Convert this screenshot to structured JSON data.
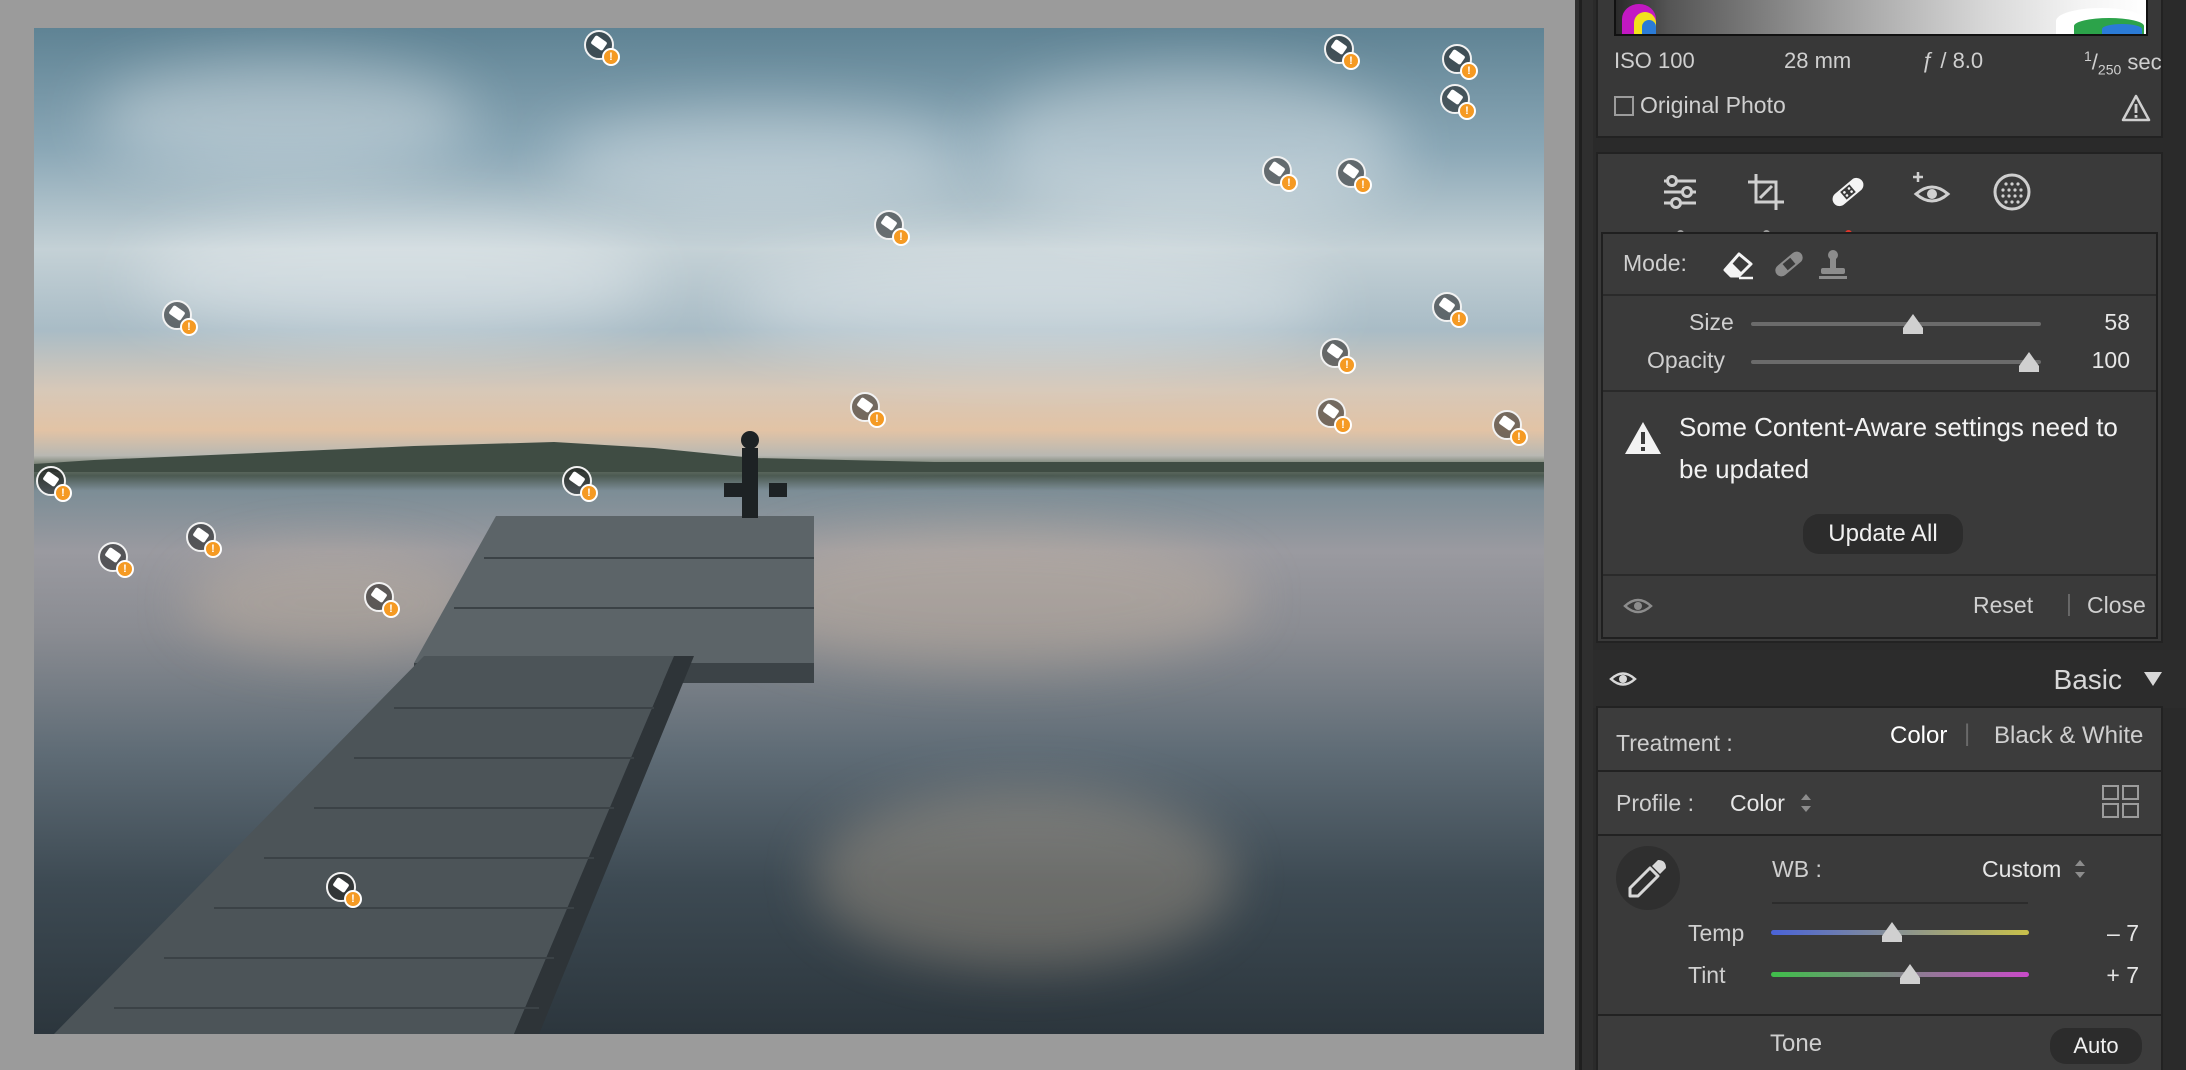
{
  "histogram_info": {
    "iso": "ISO 100",
    "focal_length": "28 mm",
    "aperture": "ƒ / 8.0",
    "shutter_num": "1",
    "shutter_den": "250",
    "shutter_unit": "sec",
    "original_photo_label": "Original Photo"
  },
  "tools": [
    {
      "name": "edit-sliders-icon",
      "active": false
    },
    {
      "name": "crop-icon",
      "active": false
    },
    {
      "name": "healing-icon",
      "active": true
    },
    {
      "name": "red-eye-icon",
      "active": false
    },
    {
      "name": "masking-icon",
      "active": false
    }
  ],
  "healing": {
    "mode_label": "Mode:",
    "modes": [
      "content-aware-remove-icon",
      "heal-icon",
      "clone-icon"
    ],
    "size_label": "Size",
    "size_value": "58",
    "size_fraction": 0.56,
    "opacity_label": "Opacity",
    "opacity_value": "100",
    "opacity_fraction": 0.96,
    "warning_text": "Some Content-Aware settings need to be updated",
    "update_all_label": "Update All",
    "reset_label": "Reset",
    "close_label": "Close"
  },
  "basic": {
    "title": "Basic",
    "treatment_label": "Treatment :",
    "treatment_color": "Color",
    "treatment_bw": "Black & White",
    "profile_label": "Profile :",
    "profile_value": "Color",
    "wb_label": "WB :",
    "wb_value": "Custom",
    "temp_label": "Temp",
    "temp_value": "– 7",
    "temp_fraction": 0.47,
    "tint_label": "Tint",
    "tint_value": "+ 7",
    "tint_fraction": 0.54,
    "tone_label": "Tone",
    "auto_label": "Auto"
  },
  "colors": {
    "accent_active": "#e0362a",
    "warning_pin": "#f59a23"
  }
}
